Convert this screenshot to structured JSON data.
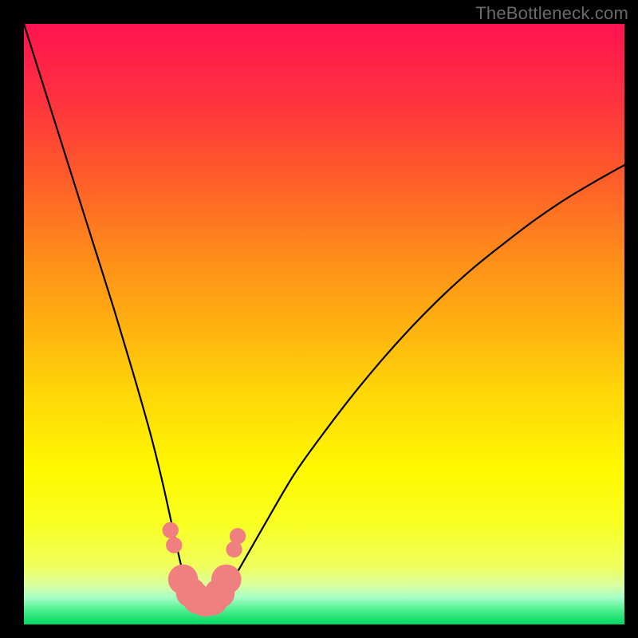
{
  "watermark": "TheBottleneck.com",
  "chart_data": {
    "type": "line",
    "title": "",
    "xlabel": "",
    "ylabel": "",
    "xlim": [
      0,
      100
    ],
    "ylim": [
      0,
      100
    ],
    "grid": false,
    "series": [
      {
        "name": "bottleneck-curve",
        "x": [
          0,
          3,
          6,
          9,
          12,
          15,
          18,
          21,
          23,
          25,
          26.5,
          28,
          29.5,
          31,
          33,
          36,
          40,
          45,
          50,
          55,
          60,
          65,
          70,
          75,
          80,
          85,
          90,
          95,
          100
        ],
        "y": [
          100,
          90.5,
          81,
          71.5,
          62,
          52.5,
          42.5,
          32,
          24,
          15,
          8.5,
          3.5,
          2.0,
          2.2,
          4.5,
          9.5,
          16.5,
          25,
          32,
          38.5,
          44.5,
          50,
          55,
          59.5,
          63.5,
          67.3,
          70.7,
          73.7,
          76.5
        ]
      }
    ],
    "highlight_points": {
      "name": "bottom-highlight",
      "color": "#f08080",
      "points": [
        {
          "x": 24.4,
          "y": 15.7,
          "r": 1.35
        },
        {
          "x": 25.0,
          "y": 13.2,
          "r": 1.35
        },
        {
          "x": 26.5,
          "y": 7.5,
          "r": 2.5
        },
        {
          "x": 27.8,
          "y": 5.3,
          "r": 2.5
        },
        {
          "x": 29.0,
          "y": 4.2,
          "r": 2.5
        },
        {
          "x": 30.2,
          "y": 3.8,
          "r": 2.5
        },
        {
          "x": 31.4,
          "y": 4.0,
          "r": 2.5
        },
        {
          "x": 32.6,
          "y": 5.2,
          "r": 2.5
        },
        {
          "x": 33.7,
          "y": 7.5,
          "r": 2.5
        },
        {
          "x": 35.0,
          "y": 12.5,
          "r": 1.35
        },
        {
          "x": 35.6,
          "y": 14.7,
          "r": 1.35
        }
      ]
    },
    "gradient_bands": [
      {
        "offset": 0.0,
        "color": "#ff1450"
      },
      {
        "offset": 0.12,
        "color": "#ff3040"
      },
      {
        "offset": 0.25,
        "color": "#ff5a2a"
      },
      {
        "offset": 0.38,
        "color": "#ff8a1a"
      },
      {
        "offset": 0.5,
        "color": "#ffb010"
      },
      {
        "offset": 0.62,
        "color": "#ffd808"
      },
      {
        "offset": 0.74,
        "color": "#fff800"
      },
      {
        "offset": 0.83,
        "color": "#f8ff20"
      },
      {
        "offset": 0.905,
        "color": "#f0ff60"
      },
      {
        "offset": 0.935,
        "color": "#d8ffa0"
      },
      {
        "offset": 0.955,
        "color": "#a8ffc8"
      },
      {
        "offset": 0.975,
        "color": "#50f090"
      },
      {
        "offset": 1.0,
        "color": "#00d860"
      }
    ]
  }
}
